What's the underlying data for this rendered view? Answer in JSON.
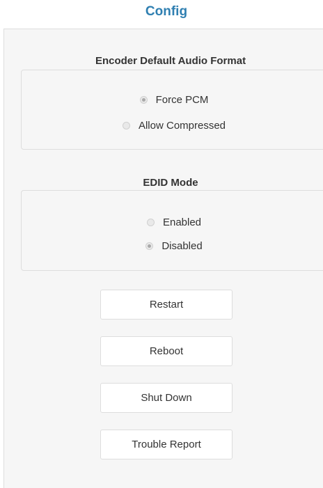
{
  "page": {
    "title": "Config"
  },
  "audio_format": {
    "label": "Encoder Default Audio Format",
    "options": [
      {
        "label": "Force PCM",
        "selected": true
      },
      {
        "label": "Allow Compressed",
        "selected": false
      }
    ]
  },
  "edid_mode": {
    "label": "EDID Mode",
    "options": [
      {
        "label": "Enabled",
        "selected": false
      },
      {
        "label": "Disabled",
        "selected": true
      }
    ]
  },
  "actions": {
    "restart_label": "Restart",
    "reboot_label": "Reboot",
    "shutdown_label": "Shut Down",
    "trouble_report_label": "Trouble Report"
  },
  "colors": {
    "title": "#2f7fb1",
    "panel_background": "#f6f6f6",
    "border": "#dddddd",
    "text": "#333333"
  }
}
